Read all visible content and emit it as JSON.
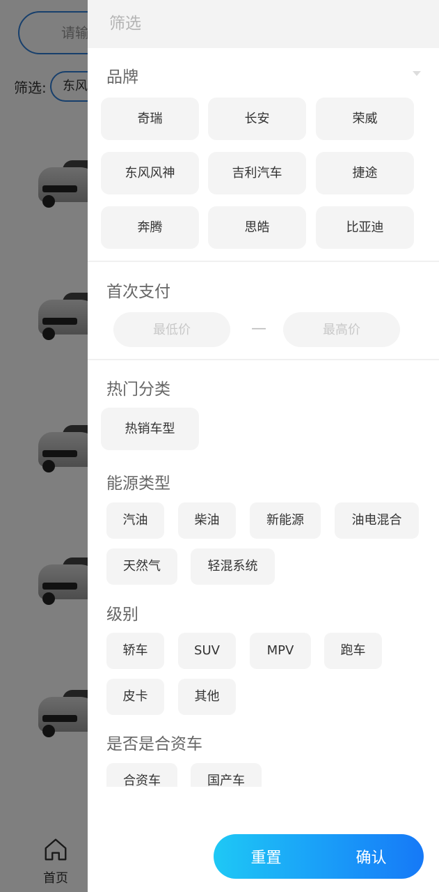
{
  "background": {
    "search_placeholder": "请输",
    "filter_label": "筛选:",
    "active_filter_chip": "东风",
    "tabbar": {
      "home_label": "首页"
    }
  },
  "drawer": {
    "title": "筛选",
    "brand": {
      "title": "品牌",
      "items": [
        "奇瑞",
        "长安",
        "荣威",
        "东风风神",
        "吉利汽车",
        "捷途",
        "奔腾",
        "思皓",
        "比亚迪"
      ]
    },
    "down_payment": {
      "title": "首次支付",
      "min_placeholder": "最低价",
      "max_placeholder": "最高价",
      "separator": "—"
    },
    "hot_category": {
      "title": "热门分类",
      "items": [
        "热销车型"
      ]
    },
    "energy_type": {
      "title": "能源类型",
      "items": [
        "汽油",
        "柴油",
        "新能源",
        "油电混合",
        "天然气",
        "轻混系统"
      ]
    },
    "level": {
      "title": "级别",
      "items": [
        "轿车",
        "SUV",
        "MPV",
        "跑车",
        "皮卡",
        "其他"
      ]
    },
    "joint_venture": {
      "title": "是否是合资车",
      "items": [
        "合资车",
        "国产车"
      ]
    },
    "reset_label": "重置",
    "confirm_label": "确认"
  },
  "colors": {
    "accent_start": "#1ec8f5",
    "accent_end": "#1679f7",
    "chip_bg": "#f4f4f4",
    "overlay": "rgba(0,0,0,0.5)"
  }
}
